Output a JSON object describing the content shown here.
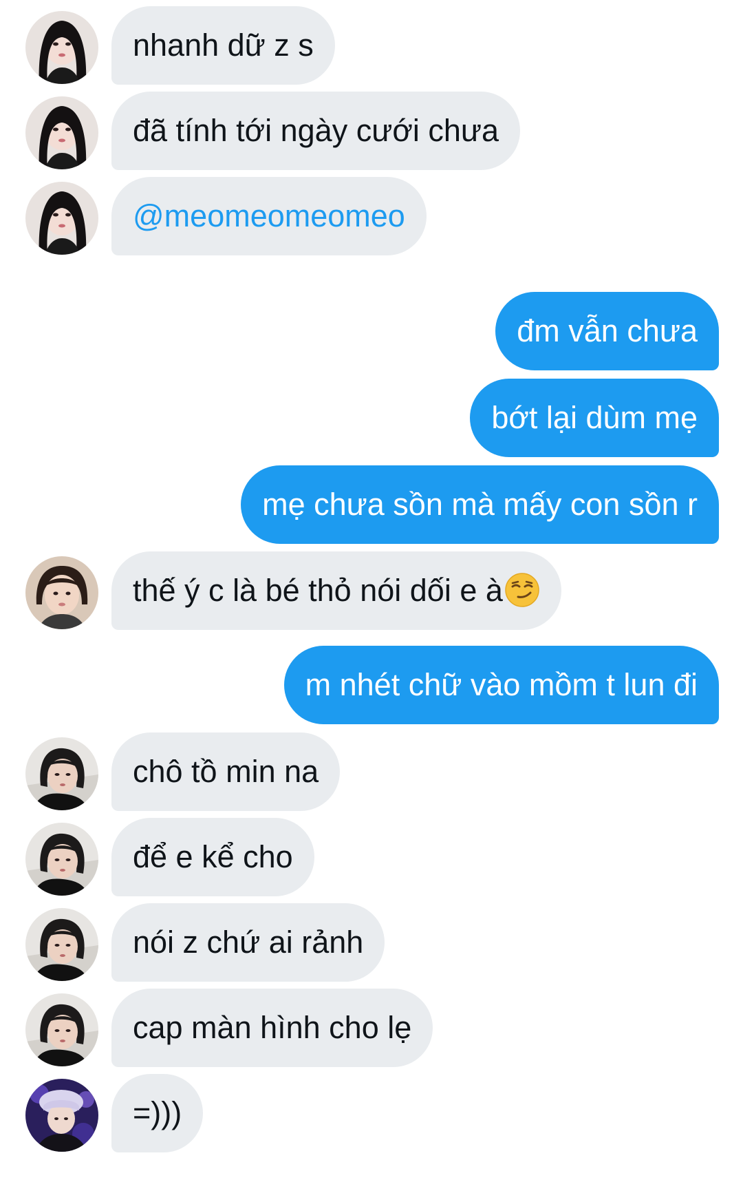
{
  "conversation": {
    "messages": [
      {
        "text": "nhanh dữ z s",
        "direction": "in",
        "avatar": "avatar-girl-dark-hair-1"
      },
      {
        "text": "đã tính tới ngày cưới chưa",
        "direction": "in",
        "avatar": "avatar-girl-dark-hair-1"
      },
      {
        "text": "@meomeomeomeo",
        "direction": "in",
        "type": "mention",
        "avatar": "avatar-girl-dark-hair-1"
      },
      {
        "text": "đm vẫn chưa",
        "direction": "out"
      },
      {
        "text": "bớt lại dùm mẹ",
        "direction": "out"
      },
      {
        "text": "mẹ chưa sồn mà mấy con sồn r",
        "direction": "out"
      },
      {
        "text": "thế ý c là bé thỏ nói dối e à",
        "emoji": "smirking-face",
        "direction": "in",
        "avatar": "avatar-girl-short-hair"
      },
      {
        "text": "m nhét chữ vào mồm t lun đi",
        "direction": "out"
      },
      {
        "text": "chô tồ min na",
        "direction": "in",
        "avatar": "avatar-girl-pillow"
      },
      {
        "text": "để e kể cho",
        "direction": "in",
        "avatar": "avatar-girl-pillow"
      },
      {
        "text": "nói z chứ ai rảnh",
        "direction": "in",
        "avatar": "avatar-girl-pillow"
      },
      {
        "text": "cap màn hình cho lẹ",
        "direction": "in",
        "avatar": "avatar-girl-pillow"
      },
      {
        "text": "=)))",
        "direction": "in",
        "avatar": "avatar-purple-hat"
      }
    ]
  },
  "colors": {
    "incoming_bubble": "#e9ecef",
    "outgoing_bubble": "#1d9bf0",
    "mention": "#1d9bf0",
    "text_dark": "#0f1419",
    "text_light": "#ffffff"
  }
}
